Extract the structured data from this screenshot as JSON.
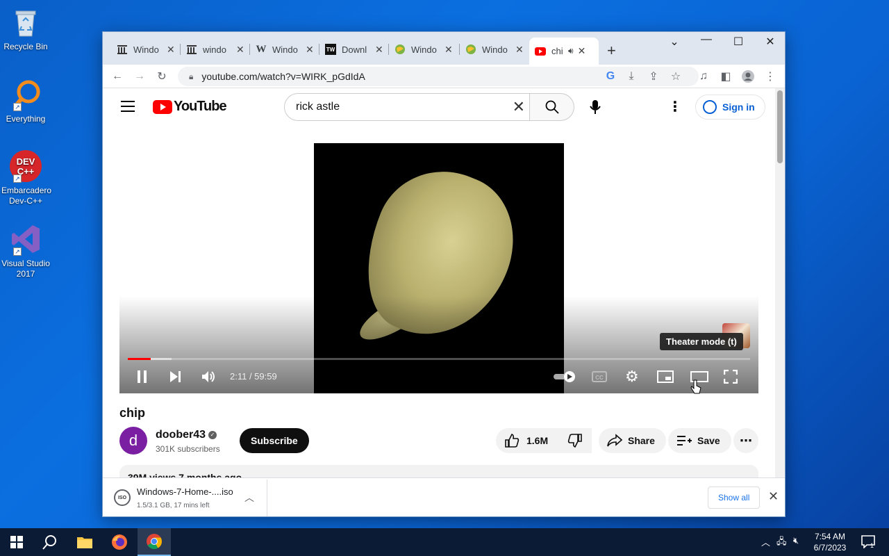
{
  "desktop": {
    "icons": [
      {
        "label": "Recycle Bin"
      },
      {
        "label": "Everything"
      },
      {
        "label": "Embarcadero Dev-C++"
      },
      {
        "label": "Visual Studio 2017"
      }
    ]
  },
  "browser": {
    "tabs": [
      {
        "title": "Windo",
        "favicon": "archive-icon"
      },
      {
        "title": "windo",
        "favicon": "archive-icon"
      },
      {
        "title": "Windo",
        "favicon": "wikipedia-icon",
        "glyph": "W"
      },
      {
        "title": "Downl",
        "favicon": "tw-icon",
        "glyph": "TW"
      },
      {
        "title": "Windo",
        "favicon": "globe-icon"
      },
      {
        "title": "Windo",
        "favicon": "globe-icon"
      },
      {
        "title": "chi",
        "favicon": "youtube-icon",
        "active": true,
        "audio": true
      }
    ],
    "url": "youtube.com/watch?v=WIRK_pGdIdA"
  },
  "youtube": {
    "logo_text": "YouTube",
    "search_value": "rick astle",
    "sign_in": "Sign in",
    "player": {
      "time": "2:11 / 59:59",
      "progress_played": 0.037,
      "progress_buffered": 0.07,
      "tooltip": "Theater mode (t)"
    },
    "video_title": "chip",
    "channel": {
      "avatar_letter": "d",
      "name": "doober43",
      "subscribers": "301K subscribers"
    },
    "subscribe_label": "Subscribe",
    "likes": "1.6M",
    "share_label": "Share",
    "save_label": "Save",
    "description_preview": "39M views  7 months ago"
  },
  "downloads": {
    "file_name": "Windows-7-Home-....iso",
    "status": "1.5/3.1 GB, 17 mins left",
    "icon_text": "ISO",
    "show_all": "Show all"
  },
  "taskbar": {
    "time": "7:54 AM",
    "date": "6/7/2023",
    "notification_count": "1"
  }
}
